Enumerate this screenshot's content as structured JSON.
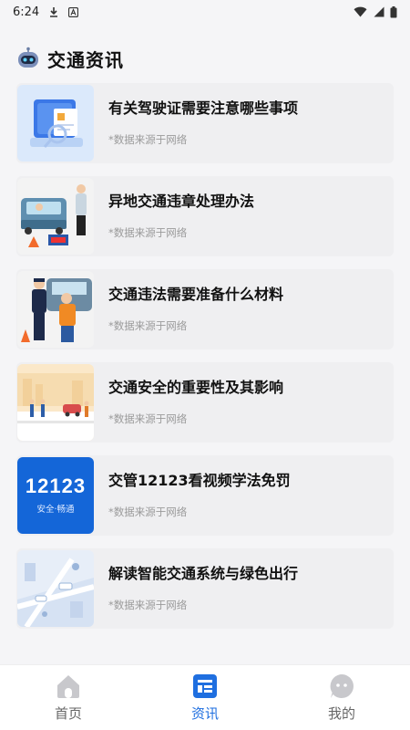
{
  "status": {
    "time": "6:24",
    "icons": [
      "download-icon",
      "notification-a-icon",
      "wifi-icon",
      "signal-icon",
      "battery-icon"
    ]
  },
  "header": {
    "title": "交通资讯",
    "icon": "robot-icon"
  },
  "articles": [
    {
      "title": "有关驾驶证需要注意哪些事项",
      "source": "*数据来源于网络",
      "thumb": "license-illustration"
    },
    {
      "title": "异地交通违章处理办法",
      "source": "*数据来源于网络",
      "thumb": "traffic-police-car-illustration"
    },
    {
      "title": "交通违法需要准备什么材料",
      "source": "*数据来源于网络",
      "thumb": "police-inspection-illustration"
    },
    {
      "title": "交通安全的重要性及其影响",
      "source": "*数据来源于网络",
      "thumb": "crosswalk-illustration"
    },
    {
      "title": "交管12123看视频学法免罚",
      "source": "*数据来源于网络",
      "thumb": "12123-logo",
      "logo_text": "12123",
      "logo_sub": "安全·畅通"
    },
    {
      "title": "解读智能交通系统与绿色出行",
      "source": "*数据来源于网络",
      "thumb": "smart-city-illustration"
    }
  ],
  "tabs": [
    {
      "label": "首页",
      "icon": "home-icon",
      "active": false
    },
    {
      "label": "资讯",
      "icon": "news-icon",
      "active": true
    },
    {
      "label": "我的",
      "icon": "profile-icon",
      "active": false
    }
  ],
  "colors": {
    "accent": "#1f6fe0",
    "inactive": "#c8c8cc",
    "card_bg": "#efeff1",
    "page_bg": "#f5f5f7"
  }
}
